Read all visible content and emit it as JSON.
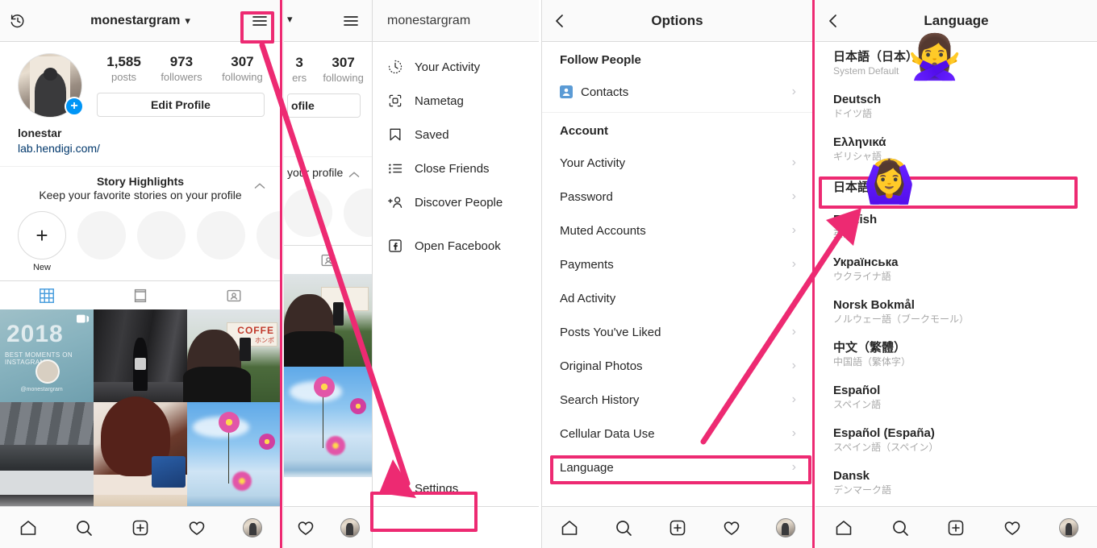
{
  "accent": {
    "pink": "#ED2A72",
    "blue": "#0095f6",
    "link": "#00376b"
  },
  "profile_panel": {
    "navbar": {
      "back_icon": "history-clock-icon",
      "username": "monestargram",
      "chevron": "⌄",
      "menu_icon": "hamburger-menu-icon"
    },
    "stats": [
      {
        "num": "1,585",
        "label": "posts"
      },
      {
        "num": "973",
        "label": "followers"
      },
      {
        "num": "307",
        "label": "following"
      }
    ],
    "edit_profile_label": "Edit Profile",
    "bio_name": "lonestar",
    "bio_link": "lab.hendigi.com/",
    "highlights": {
      "title": "Story Highlights",
      "subtitle": "Keep your favorite stories on your profile",
      "new_label": "New",
      "plus": "+"
    },
    "tabs": [
      {
        "icon": "grid-tab-icon",
        "active": true
      },
      {
        "icon": "list-tab-icon",
        "active": false
      },
      {
        "icon": "tagged-tab-icon",
        "active": false
      }
    ],
    "grid_cells": [
      {
        "name": "post-2018-best-moments",
        "year": "2018",
        "caption": "BEST MOMENTS ON INSTAGRAM",
        "handle": "@monestargram",
        "badge": "carousel-icon"
      },
      {
        "name": "post-station-bw",
        "year": "",
        "caption": "",
        "handle": "",
        "badge": ""
      },
      {
        "name": "post-coffee-sign",
        "year": "",
        "caption": "COFFE",
        "handle": "ホンポ",
        "badge": ""
      },
      {
        "name": "post-underpass-bw",
        "year": "",
        "caption": "",
        "handle": "",
        "badge": ""
      },
      {
        "name": "post-hair-tablet",
        "year": "",
        "caption": "",
        "handle": "",
        "badge": ""
      },
      {
        "name": "post-cosmos-flowers",
        "year": "",
        "caption": "",
        "handle": "",
        "badge": ""
      },
      {
        "name": "post-partial-a",
        "year": "",
        "caption": "",
        "handle": "",
        "badge": ""
      },
      {
        "name": "post-partial-b",
        "year": "",
        "caption": "",
        "handle": "",
        "badge": ""
      },
      {
        "name": "post-partial-c",
        "year": "",
        "caption": "",
        "handle": "",
        "badge": ""
      }
    ]
  },
  "profile_panel_2": {
    "stat": {
      "num_partial": "3",
      "label_partial": "ers"
    },
    "stat2": {
      "num": "307",
      "label": "following"
    },
    "edit_profile_partial": "ofile",
    "highlight_sub_partial": "your profile"
  },
  "menu_panel": {
    "navbar_title": "monestargram",
    "items": [
      {
        "icon": "your-activity-clock-icon",
        "label": "Your Activity"
      },
      {
        "icon": "nametag-icon",
        "label": "Nametag"
      },
      {
        "icon": "saved-bookmark-icon",
        "label": "Saved"
      },
      {
        "icon": "close-friends-list-icon",
        "label": "Close Friends"
      },
      {
        "icon": "discover-people-icon",
        "label": "Discover People"
      },
      {
        "icon": "facebook-icon",
        "label": "Open Facebook"
      }
    ],
    "settings": {
      "icon": "settings-gear-icon",
      "label": "Settings"
    }
  },
  "options_panel": {
    "navbar": {
      "back_icon": "back-chevron-icon",
      "title": "Options"
    },
    "groups": [
      {
        "header": "Follow People",
        "rows": [
          {
            "label": "Contacts",
            "icon": "contacts-icon",
            "chevron": "›"
          }
        ]
      },
      {
        "header": "Account",
        "rows": [
          {
            "label": "Your Activity",
            "icon": "",
            "chevron": "›"
          },
          {
            "label": "Password",
            "icon": "",
            "chevron": "›"
          },
          {
            "label": "Muted Accounts",
            "icon": "",
            "chevron": "›"
          },
          {
            "label": "Payments",
            "icon": "",
            "chevron": "›"
          },
          {
            "label": "Ad Activity",
            "icon": "",
            "chevron": ""
          },
          {
            "label": "Posts You've Liked",
            "icon": "",
            "chevron": "›"
          },
          {
            "label": "Original Photos",
            "icon": "",
            "chevron": "›"
          },
          {
            "label": "Search History",
            "icon": "",
            "chevron": "›"
          },
          {
            "label": "Cellular Data Use",
            "icon": "",
            "chevron": "›"
          },
          {
            "label": "Language",
            "icon": "",
            "chevron": "›"
          }
        ]
      }
    ]
  },
  "language_panel": {
    "navbar": {
      "back_icon": "back-chevron-icon",
      "title": "Language"
    },
    "languages": [
      {
        "main": "日本語（日本）",
        "sub": "System Default"
      },
      {
        "main": "Deutsch",
        "sub": "ドイツ語"
      },
      {
        "main": "Ελληνικά",
        "sub": "ギリシャ語"
      },
      {
        "main": "日本語",
        "sub": ""
      },
      {
        "main": "English",
        "sub": "英語"
      },
      {
        "main": "Українська",
        "sub": "ウクライナ語"
      },
      {
        "main": "Norsk Bokmål",
        "sub": "ノルウェー語（ブークモール）"
      },
      {
        "main": "中文（繁體）",
        "sub": "中国語（繁体字）"
      },
      {
        "main": "Español",
        "sub": "スペイン語"
      },
      {
        "main": "Español (España)",
        "sub": "スペイン語（スペイン）"
      },
      {
        "main": "Dansk",
        "sub": "デンマーク語"
      }
    ]
  },
  "bottom_nav": {
    "items": [
      {
        "icon": "home-icon"
      },
      {
        "icon": "search-icon"
      },
      {
        "icon": "add-post-icon"
      },
      {
        "icon": "heart-activity-icon"
      },
      {
        "icon": "profile-avatar-icon"
      }
    ]
  },
  "annotations": {
    "emoji_no": "🙅‍♀️",
    "emoji_ok": "🙆‍♀️",
    "boxes": [
      {
        "name": "hamburger-menu-highlight"
      },
      {
        "name": "settings-highlight"
      },
      {
        "name": "language-row-highlight"
      },
      {
        "name": "japanese-language-highlight"
      }
    ]
  }
}
